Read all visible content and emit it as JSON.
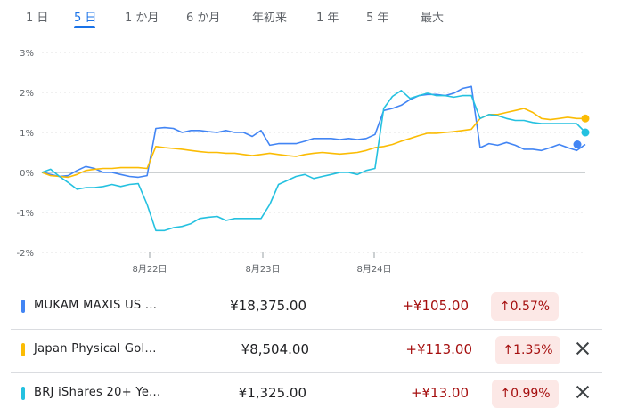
{
  "tabs": [
    {
      "label": "1 日",
      "active": false
    },
    {
      "label": "5 日",
      "active": true
    },
    {
      "label": "1 か月",
      "active": false
    },
    {
      "label": "6 か月",
      "active": false
    },
    {
      "label": "年初来",
      "active": false
    },
    {
      "label": "1 年",
      "active": false
    },
    {
      "label": "5 年",
      "active": false
    },
    {
      "label": "最大",
      "active": false
    }
  ],
  "chart_data": {
    "type": "line",
    "title": "",
    "xlabel": "",
    "ylabel": "",
    "x_ticks": [
      "8月22日",
      "8月23日",
      "8月24日"
    ],
    "y_ticks": [
      "3%",
      "2%",
      "1%",
      "0%",
      "-1%",
      "-2%"
    ],
    "ylim": [
      -2,
      3
    ],
    "y_unit": "%",
    "grid": "dashed horizontal gridlines, solid 0% baseline",
    "series": [
      {
        "color": "#4285f4",
        "values": [
          0.0,
          -0.05,
          -0.1,
          -0.08,
          0.05,
          0.15,
          0.1,
          0.0,
          0.0,
          -0.05,
          -0.1,
          -0.12,
          -0.08,
          1.1,
          1.12,
          1.1,
          1.0,
          1.05,
          1.05,
          1.02,
          1.0,
          1.05,
          1.0,
          1.0,
          0.9,
          1.05,
          0.68,
          0.72,
          0.72,
          0.72,
          0.78,
          0.85,
          0.85,
          0.85,
          0.82,
          0.85,
          0.82,
          0.85,
          0.95,
          1.55,
          1.6,
          1.68,
          1.82,
          1.92,
          1.95,
          1.95,
          1.92,
          1.98,
          2.1,
          2.15,
          0.62,
          0.72,
          0.68,
          0.75,
          0.68,
          0.58,
          0.58,
          0.55,
          0.62,
          0.7,
          0.62,
          0.55,
          0.7
        ]
      },
      {
        "color": "#fbbc04",
        "values": [
          0.0,
          -0.08,
          -0.1,
          -0.12,
          -0.05,
          0.05,
          0.08,
          0.1,
          0.1,
          0.12,
          0.12,
          0.12,
          0.1,
          0.65,
          0.62,
          0.6,
          0.58,
          0.55,
          0.52,
          0.5,
          0.5,
          0.48,
          0.48,
          0.45,
          0.42,
          0.45,
          0.48,
          0.45,
          0.42,
          0.4,
          0.45,
          0.48,
          0.5,
          0.48,
          0.46,
          0.48,
          0.5,
          0.55,
          0.62,
          0.65,
          0.7,
          0.78,
          0.85,
          0.92,
          0.98,
          0.98,
          1.0,
          1.02,
          1.05,
          1.08,
          1.35,
          1.45,
          1.45,
          1.5,
          1.55,
          1.6,
          1.5,
          1.35,
          1.32,
          1.35,
          1.38,
          1.35,
          1.35
        ]
      },
      {
        "color": "#24c1e0",
        "values": [
          0.0,
          0.08,
          -0.1,
          -0.25,
          -0.42,
          -0.38,
          -0.38,
          -0.35,
          -0.3,
          -0.35,
          -0.3,
          -0.28,
          -0.8,
          -1.45,
          -1.45,
          -1.38,
          -1.35,
          -1.28,
          -1.15,
          -1.12,
          -1.1,
          -1.2,
          -1.15,
          -1.15,
          -1.15,
          -1.15,
          -0.8,
          -0.3,
          -0.2,
          -0.1,
          -0.05,
          -0.15,
          -0.1,
          -0.05,
          0.0,
          0.0,
          -0.05,
          0.05,
          0.1,
          1.6,
          1.9,
          2.05,
          1.85,
          1.92,
          1.98,
          1.92,
          1.92,
          1.88,
          1.92,
          1.92,
          1.35,
          1.45,
          1.42,
          1.35,
          1.3,
          1.3,
          1.25,
          1.22,
          1.22,
          1.22,
          1.22,
          1.22,
          1.0
        ]
      }
    ]
  },
  "rows": [
    {
      "name": "MUKAM MAXIS US ...",
      "price": "¥18,375.00",
      "change": "+¥105.00",
      "badge": "0.57%",
      "arrow": "↑",
      "color": "#4285f4",
      "removable": false
    },
    {
      "name": "Japan Physical Gol...",
      "price": "¥8,504.00",
      "change": "+¥113.00",
      "badge": "1.35%",
      "arrow": "↑",
      "color": "#fbbc04",
      "removable": true
    },
    {
      "name": "BRJ iShares 20+ Ye...",
      "price": "¥1,325.00",
      "change": "+¥13.00",
      "badge": "0.99%",
      "arrow": "↑",
      "color": "#24c1e0",
      "removable": true
    }
  ]
}
